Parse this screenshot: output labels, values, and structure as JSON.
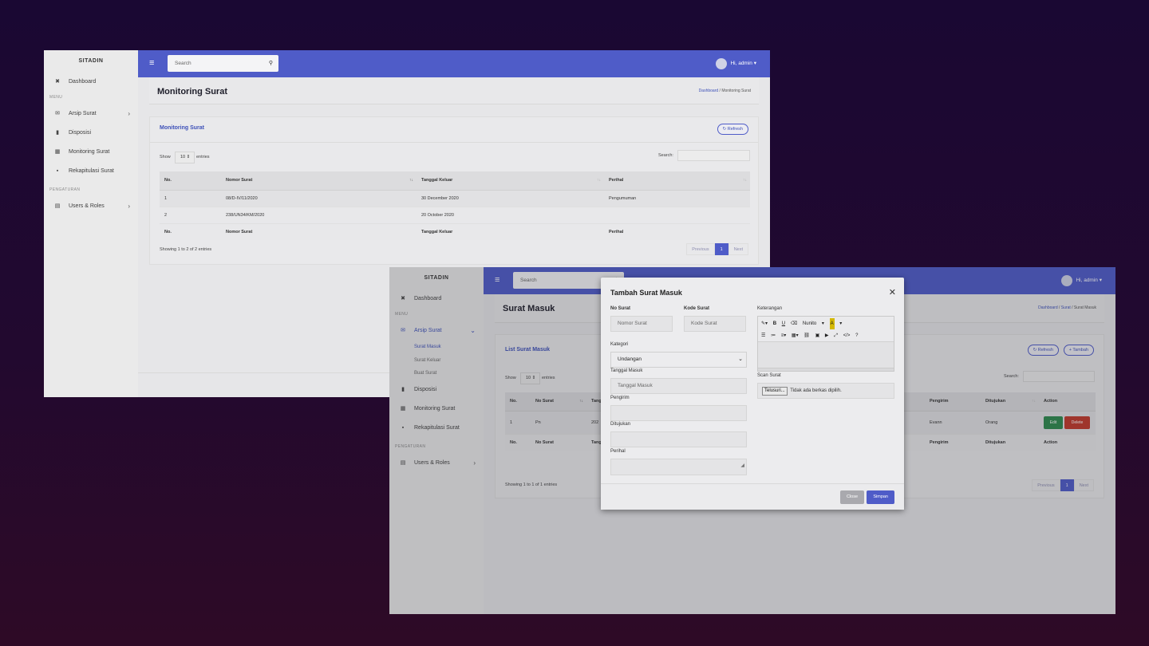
{
  "app": {
    "brand": "SITADIN",
    "user": "Hi, admin",
    "search_placeholder": "Search"
  },
  "sidebar": {
    "dashboard": "Dashboard",
    "menu_header": "MENU",
    "arsip": "Arsip Surat",
    "disposisi": "Disposisi",
    "monitoring": "Monitoring Surat",
    "rekap": "Rekapitulasi Surat",
    "pengaturan_header": "PENGATURAN",
    "users": "Users & Roles",
    "sub": [
      "Surat Masuk",
      "Surat Keluar",
      "Buat Surat"
    ]
  },
  "win1": {
    "page_title": "Monitoring Surat",
    "breadcrumb": {
      "home": "Dashboard",
      "sep": "/",
      "current": "Monitoring Surat"
    },
    "card_title": "Monitoring Surat",
    "refresh": "Refresh",
    "show": "Show",
    "entries_value": "10",
    "entries": "entries",
    "search_label": "Search:",
    "columns": [
      "No.",
      "Nomor Surat",
      "Tanggal Keluar",
      "Perihal"
    ],
    "rows": [
      [
        "1",
        "08/D-IV/11/2020",
        "30 December 2020",
        "Pengumuman"
      ],
      [
        "2",
        "238/UN34/KM/2020",
        "20 October 2020",
        ""
      ]
    ],
    "info": "Showing 1 to 2 of 2 entries",
    "prev": "Previous",
    "page": "1",
    "next": "Next"
  },
  "win2": {
    "page_title": "Surat Masuk",
    "breadcrumb": {
      "home": "Dashboard",
      "sep1": "/",
      "mid": "Surat",
      "sep2": "/",
      "current": "Surat Masuk"
    },
    "card_title": "List Surat Masuk",
    "refresh": "Refresh",
    "add": "Tambah",
    "show": "Show",
    "entries_value": "10",
    "entries": "entries",
    "search_label": "Search:",
    "columns": [
      "No.",
      "No Surat",
      "Tang",
      "Pengirim",
      "Ditujukan",
      "Action"
    ],
    "row": {
      "no": "1",
      "no_surat": "Pn",
      "tang": "202",
      "pengirim": "Evann",
      "ditujukan": "Orang"
    },
    "edit": "Edit",
    "delete": "Delete",
    "info": "Showing 1 to 1 of 1 entries",
    "prev": "Previous",
    "page": "1",
    "next": "Next"
  },
  "modal": {
    "title": "Tambah Surat Masuk",
    "no_surat_label": "No Surat",
    "no_surat_ph": "Nomor Surat",
    "kode_label": "Kode Surat",
    "kode_ph": "Kode Surat",
    "kategori_label": "Kategori",
    "kategori_value": "Undangan",
    "tgl_label": "Tanggal Masuk",
    "tgl_ph": "Tanggal Masuk",
    "pengirim_label": "Pengirim",
    "ditujukan_label": "Ditujukan",
    "perihal_label": "Perihal",
    "keterangan_label": "Keterangan",
    "font_name": "Nunito",
    "scan_label": "Scan Surat",
    "file_button": "Telusuri...",
    "file_status": "Tidak ada berkas dipilih.",
    "close": "Close",
    "save": "Simpan"
  }
}
